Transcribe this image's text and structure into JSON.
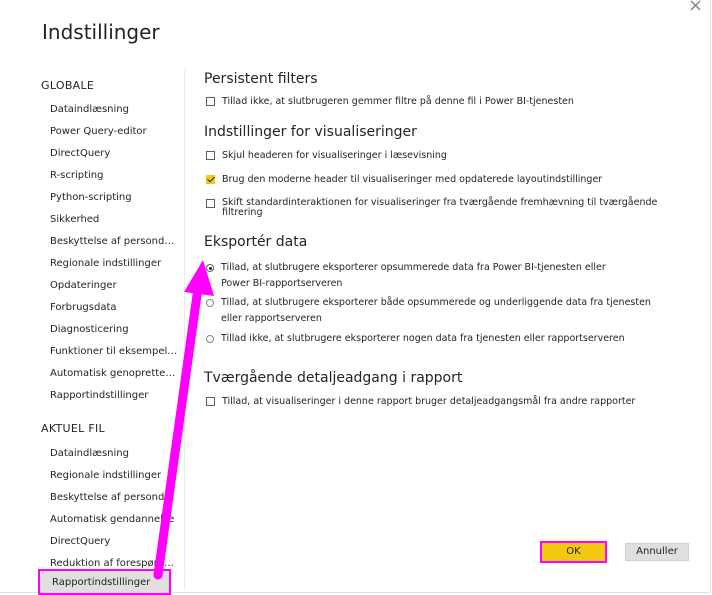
{
  "dialog": {
    "title": "Indstillinger",
    "close_glyph": "×"
  },
  "sidebar": {
    "global_heading": "GLOBALE",
    "global_items": [
      "Dataindlæsning",
      "Power Query-editor",
      "DirectQuery",
      "R-scripting",
      "Python-scripting",
      "Sikkerhed",
      "Beskyttelse af persondata",
      "Regionale indstillinger",
      "Opdateringer",
      "Forbrugsdata",
      "Diagnosticering",
      "Funktioner til eksempelvisning",
      "Automatisk genoprettelse",
      "Rapportindstillinger"
    ],
    "current_heading": "AKTUEL FIL",
    "current_items": [
      "Dataindlæsning",
      "Regionale indstillinger",
      "Beskyttelse af persondata",
      "Automatisk gendannelse",
      "DirectQuery",
      "Reduktion af forespørgsler",
      "Rapportindstillinger"
    ],
    "selected_item": "Rapportindstillinger"
  },
  "main": {
    "persistent_filters": {
      "title": "Persistent filters",
      "option": {
        "label": "Tillad ikke, at slutbrugeren gemmer filtre på denne fil i Power BI-tjenesten",
        "checked": false
      }
    },
    "visual_settings": {
      "title": "Indstillinger for visualiseringer",
      "options": [
        {
          "label": "Skjul headeren for visualiseringer i læsevisning",
          "checked": false
        },
        {
          "label": "Brug den moderne header til visualiseringer med opdaterede layoutindstillinger",
          "checked": true
        },
        {
          "label": "Skift standardinteraktionen for visualiseringer fra tværgående fremhævning til tværgående filtrering",
          "checked": false
        }
      ]
    },
    "export_data": {
      "title": "Eksportér data",
      "options": [
        {
          "label": "Tillad, at slutbrugere eksporterer opsummerede data fra Power BI-tjenesten eller Power BI-rapportserveren",
          "selected": true
        },
        {
          "label": "Tillad, at slutbrugere eksporterer både opsummerede og underliggende data fra tjenesten eller rapportserveren",
          "selected": false
        },
        {
          "label": "Tillad ikke, at slutbrugere eksporterer nogen data fra tjenesten eller rapportserveren",
          "selected": false
        }
      ]
    },
    "drillthrough": {
      "title": "Tværgående detaljeadgang i rapport",
      "option": {
        "label": "Tillad, at visualiseringer i denne rapport bruger detaljeadgangsmål fra andre rapporter",
        "checked": false
      }
    }
  },
  "footer": {
    "ok_label": "OK",
    "cancel_label": "Annuller"
  },
  "annotation": {
    "arrow_color": "#ff00ff",
    "highlight_color": "#ff00ff"
  },
  "colors": {
    "accent": "#f2c811",
    "selected_bg": "#e1dfdd",
    "text": "#252423"
  }
}
